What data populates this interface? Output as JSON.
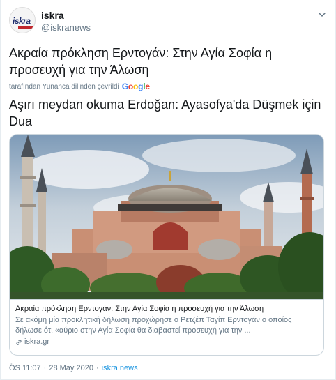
{
  "user": {
    "name": "iskra",
    "handle": "@iskranews",
    "avatar_text": "iskra"
  },
  "tweet": {
    "text": "Ακραία πρόκληση Ερντογάν: Στην Αγία Σοφία η προσευχή για την Άλωση",
    "translated_by": "tarafından Yunanca dilinden çevrildi",
    "translator": "Google",
    "translation": "Aşırı meydan okuma Erdoğan: Ayasofya'da Düşmek için Dua"
  },
  "card": {
    "title": "Ακραία πρόκληση Ερντογάν: Στην Αγία Σοφία η προσευχή για την Άλωση",
    "description": "Σε ακόμη μία προκλητική δήλωση προχώρησε ο Ρετζέπ Ταγίπ Ερντογάν ο οποίος δήλωσε ότι «αύριο στην Αγία Σοφία θα διαβαστεί προσευχή για την ...",
    "domain": "iskra.gr"
  },
  "meta": {
    "time": "ÖS 11:07",
    "sep1": "·",
    "date": "28 May 2020",
    "sep2": "·",
    "source": "iskra news"
  },
  "colors": {
    "link": "#1b95e0",
    "muted": "#657786",
    "border": "#ccd6dd"
  }
}
